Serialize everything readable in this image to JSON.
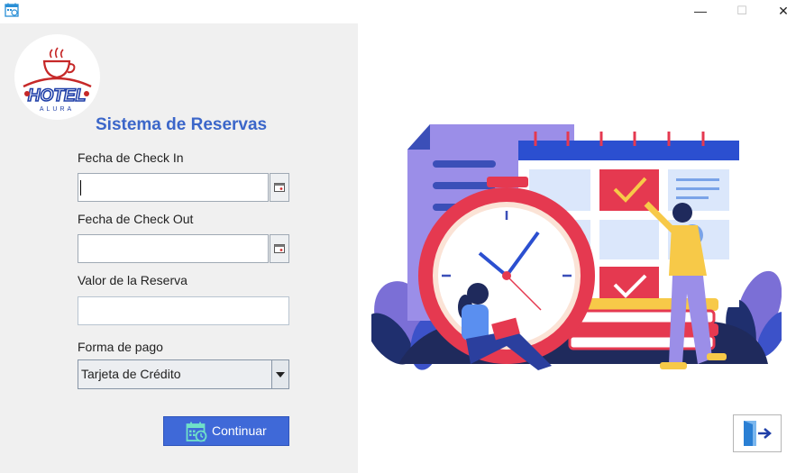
{
  "window": {
    "minimize": "—",
    "maximize": "☐",
    "close": "✕"
  },
  "logo": {
    "title": "HOTEL",
    "subtitle": "ALURA"
  },
  "form": {
    "heading": "Sistema de Reservas",
    "checkin_label": "Fecha de Check In",
    "checkin_value": "",
    "checkout_label": "Fecha de Check Out",
    "checkout_value": "",
    "valor_label": "Valor de la Reserva",
    "valor_value": "",
    "pago_label": "Forma de pago",
    "pago_selected": "Tarjeta de Crédito",
    "continue_label": "Continuar"
  },
  "colors": {
    "accent_blue": "#3f69d8",
    "heading_blue": "#3b66c9",
    "panel_bg": "#f0f0f0"
  },
  "icons": {
    "app": "calendar-icon",
    "date_picker": "calendar-icon",
    "continue": "calendar-clock-icon",
    "exit": "exit-door-icon"
  }
}
